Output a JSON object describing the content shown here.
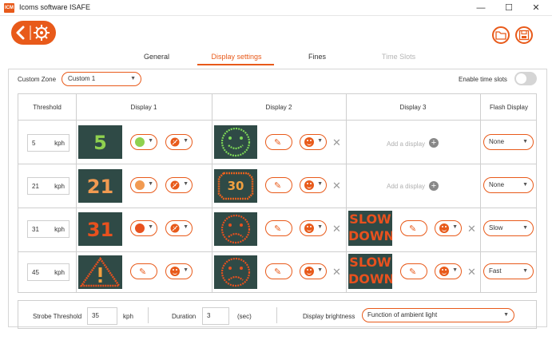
{
  "window": {
    "title": "Icoms software ISAFE",
    "icon_text": "ICM",
    "minimize": "—",
    "maximize": "☐",
    "close": "✕"
  },
  "tabs": [
    "General",
    "Display settings",
    "Fines",
    "Time Slots"
  ],
  "zone": {
    "label": "Custom Zone",
    "value": "Custom 1"
  },
  "time_slots": {
    "label": "Enable time slots",
    "enabled": false
  },
  "table": {
    "headers": [
      "Threshold",
      "Display 1",
      "Display 2",
      "Display 3",
      "Flash Display"
    ],
    "unit": "kph",
    "add_display_label": "Add a display",
    "rows": [
      {
        "threshold": "5",
        "display1_text": "5",
        "display1_color": "#8fd14f",
        "display1_dot": "#8fd14f",
        "display2_icon": "smiley-face",
        "display3": "add",
        "flash": "None"
      },
      {
        "threshold": "21",
        "display1_text": "21",
        "display1_color": "#f19a51",
        "display1_dot": "#f19a51",
        "display2_icon": "speed-sign-30",
        "display2_text": "30",
        "display3": "add",
        "flash": "None"
      },
      {
        "threshold": "31",
        "display1_text": "31",
        "display1_color": "#e8511e",
        "display1_dot": "#e8511e",
        "display2_icon": "sad-face",
        "display3": "slow-down",
        "display3_text_1": "SLOW",
        "display3_text_2": "DOWN",
        "flash": "Slow"
      },
      {
        "threshold": "45",
        "display1_icon": "warning-triangle",
        "display2_icon": "sad-face",
        "display3": "slow-down",
        "display3_text_1": "SLOW",
        "display3_text_2": "DOWN",
        "flash": "Fast"
      }
    ]
  },
  "bottom": {
    "strobe_label": "Strobe Threshold",
    "strobe_value": "35",
    "strobe_unit": "kph",
    "duration_label": "Duration",
    "duration_value": "3",
    "duration_unit": "(sec)",
    "brightness_label": "Display brightness",
    "brightness_value": "Function of ambient light"
  },
  "colors": {
    "accent": "#e85a1a",
    "led_screen": "#2f4a46",
    "smiley_green": "#7ed957"
  }
}
